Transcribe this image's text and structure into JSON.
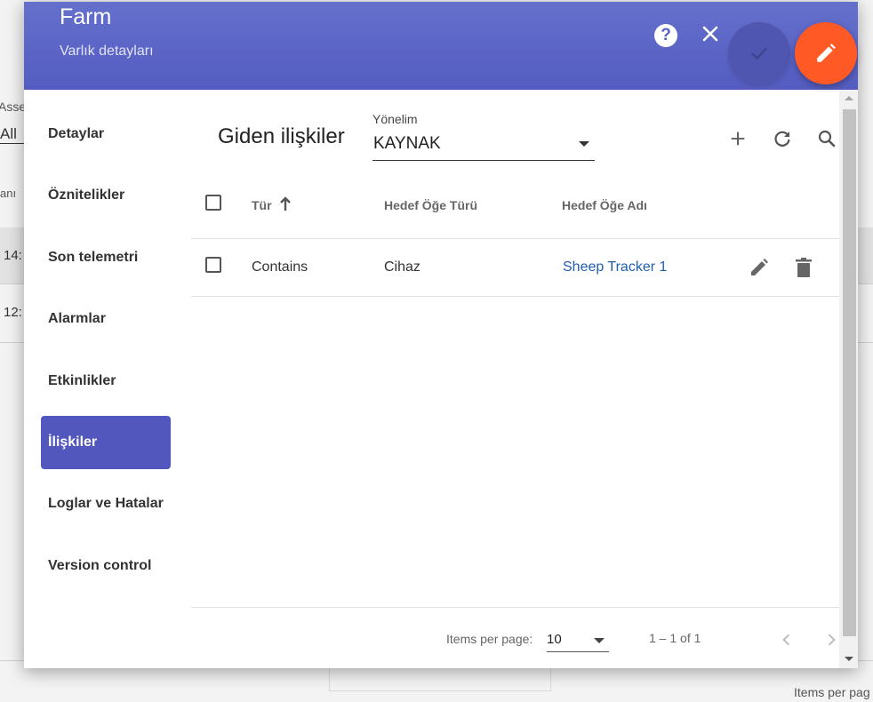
{
  "background": {
    "asset_label": "Asse",
    "filter_value": "All",
    "column_fragment": "anı",
    "rows": [
      "14:",
      "12:"
    ],
    "items_per_page": "Items per pag"
  },
  "header": {
    "title": "Farm",
    "subtitle": "Varlık detayları",
    "help_icon": "?",
    "colors": {
      "header": "#5b63c6",
      "edit_fab": "#ff5a26",
      "active_nav": "#5157bd",
      "link": "#1f5fb0"
    }
  },
  "nav": {
    "items": [
      {
        "label": "Detaylar",
        "active": false
      },
      {
        "label": "Öznitelikler",
        "active": false
      },
      {
        "label": "Son telemetri",
        "active": false
      },
      {
        "label": "Alarmlar",
        "active": false
      },
      {
        "label": "Etkinlikler",
        "active": false
      },
      {
        "label": "İlişkiler",
        "active": true
      },
      {
        "label": "Loglar ve Hatalar",
        "active": false
      },
      {
        "label": "Version control",
        "active": false
      }
    ]
  },
  "relations": {
    "title": "Giden ilişkiler",
    "direction_label": "Yönelim",
    "direction_value": "KAYNAK",
    "toolbar_icons": [
      "add-icon",
      "refresh-icon",
      "search-icon"
    ],
    "columns": [
      "Tür",
      "Hedef Öğe Türü",
      "Hedef Öğe Adı"
    ],
    "sort_icon": "arrow-up-icon",
    "rows": [
      {
        "type": "Contains",
        "target_type": "Cihaz",
        "target_name": "Sheep Tracker 1"
      }
    ]
  },
  "pager": {
    "items_per_page_label": "Items per page:",
    "page_size": "10",
    "range": "1 – 1 of 1"
  }
}
